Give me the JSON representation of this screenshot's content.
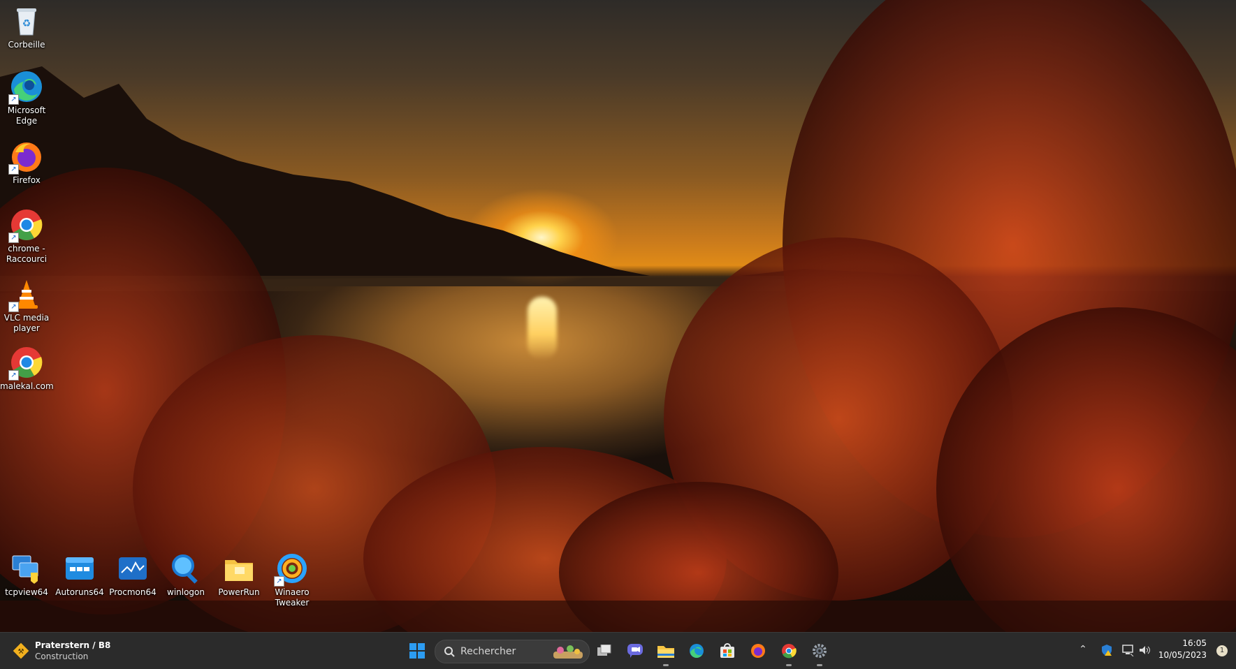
{
  "desktop": {
    "icons_left": [
      {
        "name": "recycle-bin",
        "label": "Corbeille"
      },
      {
        "name": "microsoft-edge",
        "label": "Microsoft Edge"
      },
      {
        "name": "firefox",
        "label": "Firefox"
      },
      {
        "name": "chrome-raccourci",
        "label": "chrome - Raccourci"
      },
      {
        "name": "vlc-media-player",
        "label": "VLC media player"
      },
      {
        "name": "malekal-com",
        "label": "malekal.com"
      }
    ],
    "icons_bottom": [
      {
        "name": "tcpview64",
        "label": "tcpview64"
      },
      {
        "name": "autoruns64",
        "label": "Autoruns64"
      },
      {
        "name": "procmon64",
        "label": "Procmon64"
      },
      {
        "name": "winlogon",
        "label": "winlogon"
      },
      {
        "name": "powerrun",
        "label": "PowerRun"
      },
      {
        "name": "winaero-tweaker",
        "label": "Winaero Tweaker"
      }
    ]
  },
  "taskbar": {
    "weather": {
      "title": "Praterstern / B8",
      "subtitle": "Construction"
    },
    "search": {
      "placeholder": "Rechercher"
    },
    "apps": [
      "start-button",
      "search",
      "task-view",
      "teams-chat",
      "file-explorer",
      "edge",
      "microsoft-store",
      "firefox",
      "chrome",
      "settings"
    ],
    "clock": {
      "time": "16:05",
      "date": "10/05/2023"
    },
    "notification_count": "1"
  },
  "colors": {
    "taskbar_bg": "#2b2b2b",
    "accent_start": "#2c9cf2"
  }
}
